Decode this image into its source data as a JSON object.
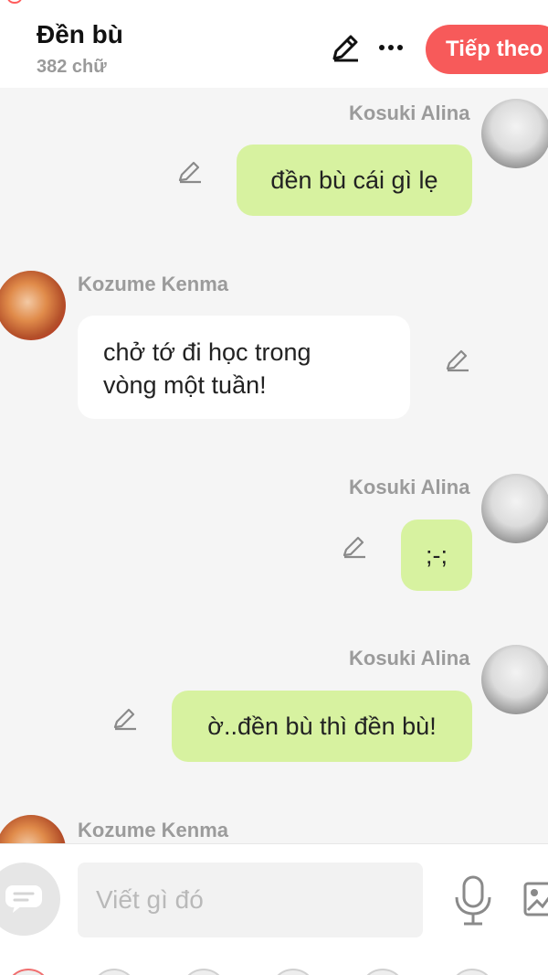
{
  "header": {
    "title": "Đền bù",
    "word_count": "382 chữ",
    "next_label": "Tiếp theo",
    "accent_color": "#f75a5a"
  },
  "messages": [
    {
      "sender": "Kosuki Alina",
      "side": "right",
      "text": "đền bù cái gì lẹ"
    },
    {
      "sender": "Kozume Kenma",
      "side": "left",
      "text_lines": [
        "chở tớ đi học trong",
        "vòng một tuần!"
      ]
    },
    {
      "sender": "Kosuki Alina",
      "side": "right",
      "text": ";-;"
    },
    {
      "sender": "Kosuki Alina",
      "side": "right",
      "text": "ờ..đền bù thì đền bù!"
    },
    {
      "sender": "Kozume Kenma",
      "side": "left",
      "text": ""
    }
  ],
  "composer": {
    "placeholder": "Viết gì đó"
  },
  "icons": {
    "edit": "pencil-icon",
    "more": "more-horizontal-icon",
    "mic": "microphone-icon",
    "image": "image-icon",
    "compose": "message-icon"
  },
  "colors": {
    "self_bubble": "#d7f2a0",
    "other_bubble": "#ffffff",
    "background": "#f5f5f5"
  }
}
